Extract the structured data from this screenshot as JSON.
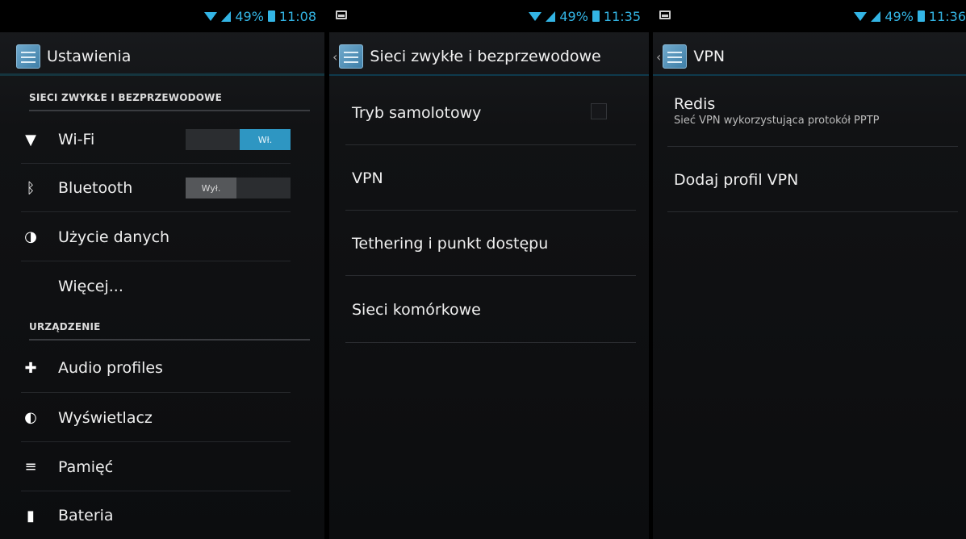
{
  "screen1": {
    "status": {
      "battery_pct": "49%",
      "time": "11:08"
    },
    "title": "Ustawienia",
    "section1": "SIECI ZWYKŁE I BEZPRZEWODOWE",
    "wifi": {
      "label": "Wi-Fi",
      "toggle": "Wł."
    },
    "bluetooth": {
      "label": "Bluetooth",
      "toggle": "Wył."
    },
    "data_usage": "Użycie danych",
    "more": "Więcej...",
    "section2": "URZĄDZENIE",
    "audio": "Audio profiles",
    "display": "Wyświetlacz",
    "storage": "Pamięć",
    "battery": "Bateria"
  },
  "screen2": {
    "status": {
      "battery_pct": "49%",
      "time": "11:35"
    },
    "title": "Sieci zwykłe i bezprzewodowe",
    "items": [
      "Tryb samolotowy",
      "VPN",
      "Tethering i punkt dostępu",
      "Sieci komórkowe"
    ]
  },
  "screen3": {
    "status": {
      "battery_pct": "49%",
      "time": "11:36"
    },
    "title": "VPN",
    "profile": {
      "name": "Redis",
      "desc": "Sieć VPN wykorzystująca protokół PPTP"
    },
    "add": "Dodaj profil VPN"
  },
  "icons": {
    "up_caret": "‹",
    "wifi": "▼",
    "bluetooth": "ᛒ",
    "data_usage": "◑",
    "audio": "✚",
    "display": "◐",
    "storage": "≡",
    "battery": "▮"
  },
  "colors": {
    "accent": "#33b5e5",
    "toggle_on": "#2e96c2"
  }
}
